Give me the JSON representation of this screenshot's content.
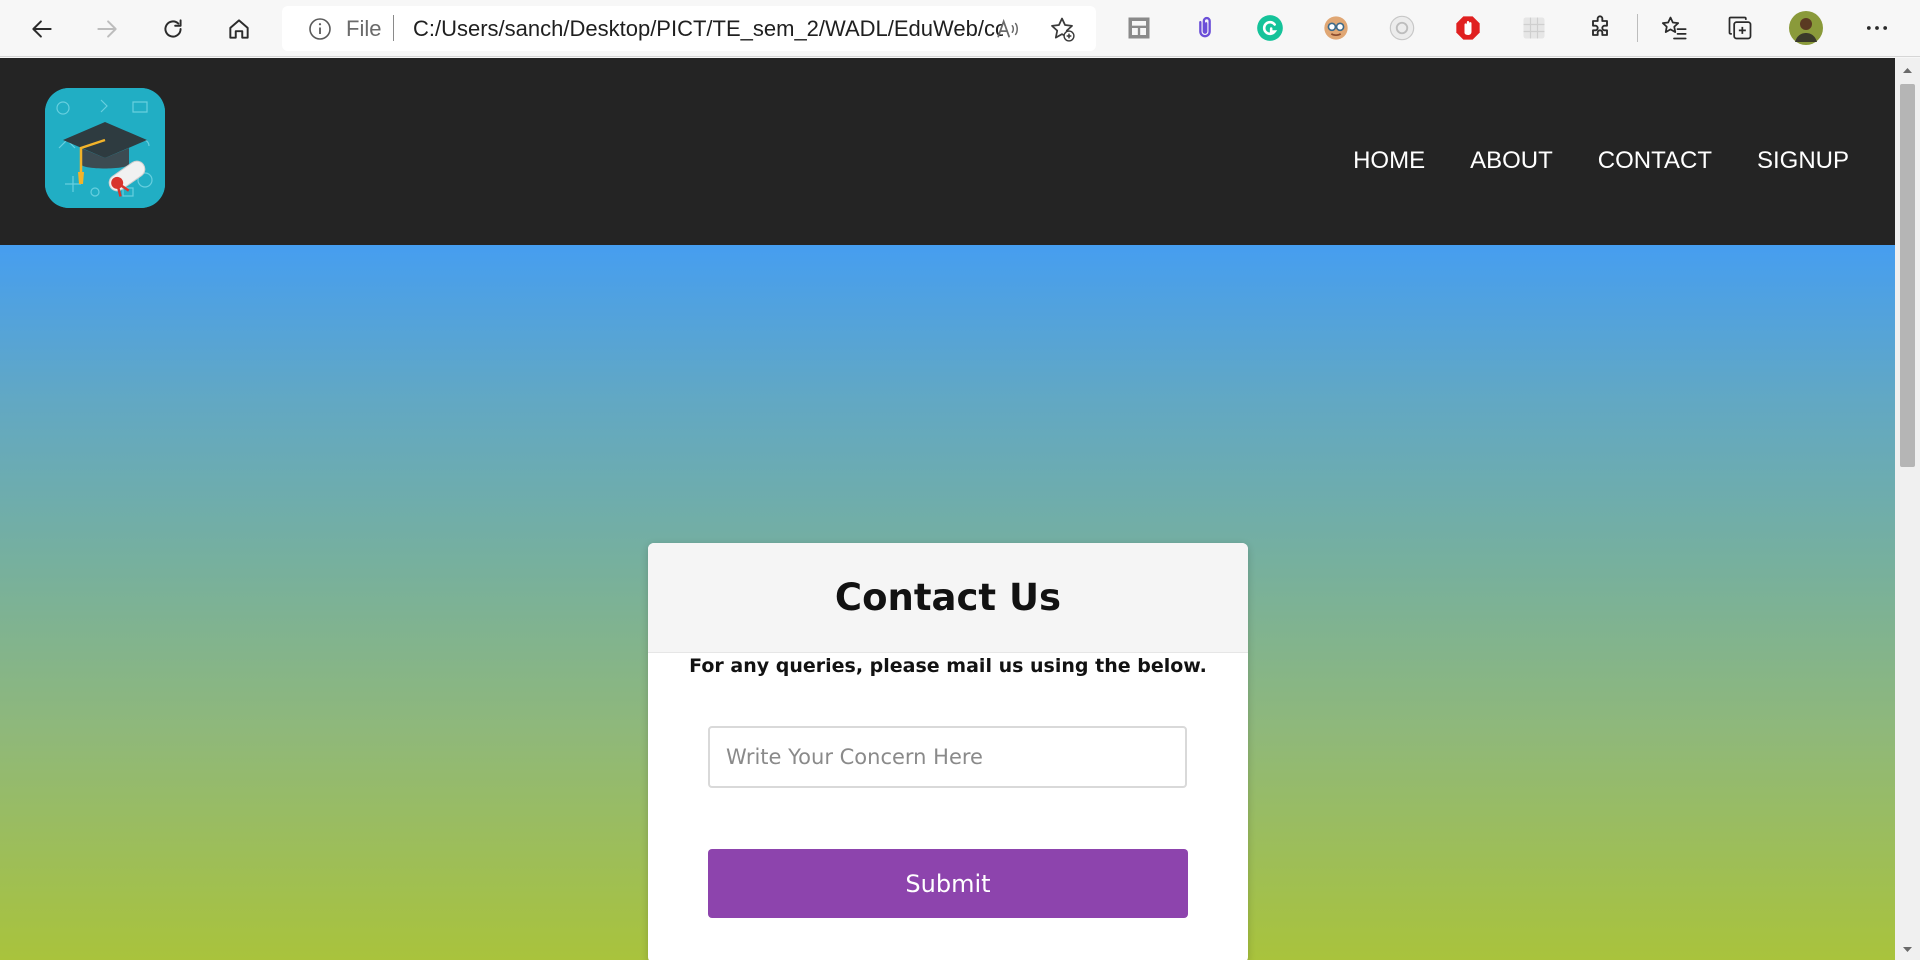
{
  "browser": {
    "address_scheme": "File",
    "url": "C:/Users/sanch/Desktop/PICT/TE_sem_2/WADL/EduWeb/co...",
    "nav_buttons": [
      "back-icon",
      "forward-icon",
      "refresh-icon",
      "home-icon"
    ],
    "extensions": [
      "web-capture-icon",
      "clip-extension-icon",
      "grammarly-icon",
      "mask-extension-icon",
      "camera-extension-icon",
      "adblock-icon",
      "grid-extension-icon",
      "extensions-puzzle-icon",
      "favorites-icon",
      "collections-icon",
      "profile-avatar",
      "more-menu-icon"
    ]
  },
  "site": {
    "nav": {
      "home": "HOME",
      "about": "ABOUT",
      "contact": "CONTACT",
      "signup": "SIGNUP"
    }
  },
  "contact": {
    "title": "Contact Us",
    "subtitle": "For any queries, please mail us using the below.",
    "concern_placeholder": "Write Your Concern Here",
    "concern_value": "",
    "submit_label": "Submit"
  },
  "colors": {
    "header_bg": "#242424",
    "gradient_top": "#469ef0",
    "gradient_bottom": "#a9c33c",
    "submit_bg": "#8d44ad",
    "logo_bg": "#21aec4"
  }
}
